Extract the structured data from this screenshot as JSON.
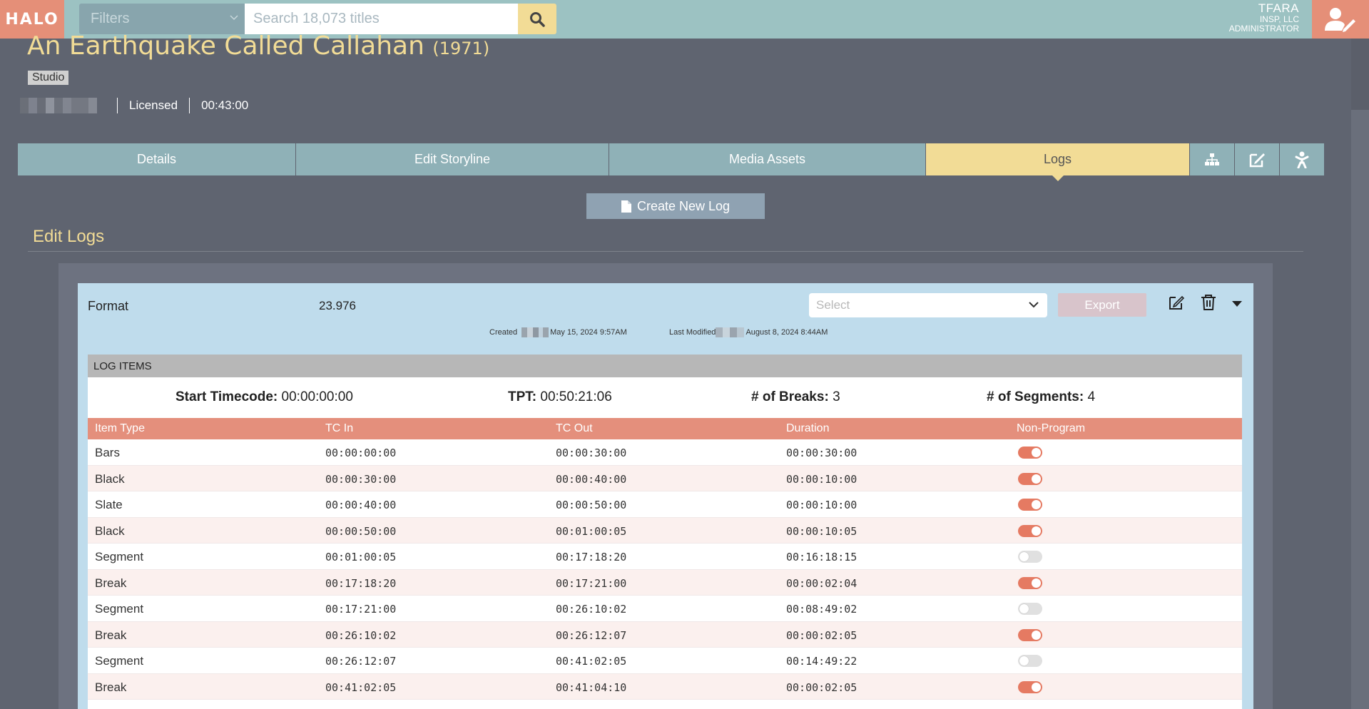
{
  "app": {
    "logo": "HALO"
  },
  "header": {
    "filters_placeholder": "Filters",
    "search_placeholder": "Search 18,073 titles",
    "user_name": "TFARA",
    "user_company": "INSP, LLC",
    "user_role": "ADMINISTRATOR"
  },
  "title": {
    "name": "An Earthquake Called Callahan",
    "year": "(1971)"
  },
  "studio_badge": "Studio",
  "meta": {
    "license": "Licensed",
    "duration": "00:43:00"
  },
  "tabs": [
    {
      "label": "Details"
    },
    {
      "label": "Edit Storyline"
    },
    {
      "label": "Media Assets"
    },
    {
      "label": "Logs"
    }
  ],
  "tab_icons": [
    "hierarchy-icon",
    "edit-icon",
    "baby-icon"
  ],
  "create_button": "Create New Log",
  "section_title": "Edit Logs",
  "log": {
    "format_label": "Format",
    "format_value": "23.976",
    "select_placeholder": "Select",
    "export_label": "Export",
    "created_label": "Created",
    "created_date": "May 15, 2024 9:57AM",
    "modified_label": "Last Modified",
    "modified_date": "August 8, 2024 8:44AM",
    "items_header": "LOG ITEMS",
    "stats": {
      "start_label": "Start Timecode:",
      "start_value": "00:00:00:00",
      "tpt_label": "TPT:",
      "tpt_value": "00:50:21:06",
      "breaks_label": "# of Breaks:",
      "breaks_value": "3",
      "segments_label": "# of Segments:",
      "segments_value": "4"
    },
    "columns": [
      "Item Type",
      "TC In",
      "TC Out",
      "Duration",
      "Non-Program"
    ],
    "rows": [
      {
        "type": "Bars",
        "in": "00:00:00:00",
        "out": "00:00:30:00",
        "dur": "00:00:30:00",
        "nonprog": true
      },
      {
        "type": "Black",
        "in": "00:00:30:00",
        "out": "00:00:40:00",
        "dur": "00:00:10:00",
        "nonprog": true
      },
      {
        "type": "Slate",
        "in": "00:00:40:00",
        "out": "00:00:50:00",
        "dur": "00:00:10:00",
        "nonprog": true
      },
      {
        "type": "Black",
        "in": "00:00:50:00",
        "out": "00:01:00:05",
        "dur": "00:00:10:05",
        "nonprog": true
      },
      {
        "type": "Segment",
        "in": "00:01:00:05",
        "out": "00:17:18:20",
        "dur": "00:16:18:15",
        "nonprog": false
      },
      {
        "type": "Break",
        "in": "00:17:18:20",
        "out": "00:17:21:00",
        "dur": "00:00:02:04",
        "nonprog": true
      },
      {
        "type": "Segment",
        "in": "00:17:21:00",
        "out": "00:26:10:02",
        "dur": "00:08:49:02",
        "nonprog": false
      },
      {
        "type": "Break",
        "in": "00:26:10:02",
        "out": "00:26:12:07",
        "dur": "00:00:02:05",
        "nonprog": true
      },
      {
        "type": "Segment",
        "in": "00:26:12:07",
        "out": "00:41:02:05",
        "dur": "00:14:49:22",
        "nonprog": false
      },
      {
        "type": "Break",
        "in": "00:41:02:05",
        "out": "00:41:04:10",
        "dur": "00:00:02:05",
        "nonprog": true
      }
    ]
  },
  "colors": {
    "accent": "#f2dc96",
    "brand": "#e58f78",
    "header": "#9cc2c2",
    "table_head": "#e48f7c"
  }
}
